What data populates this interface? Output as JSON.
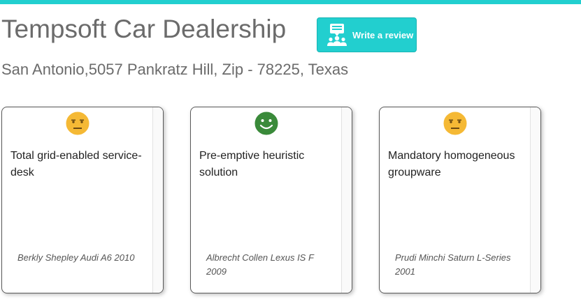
{
  "header": {
    "title": "Tempsoft Car Dealership",
    "review_button_label": "Write a review",
    "review_icon": "review-people-icon",
    "address": "San Antonio,5057 Pankratz Hill, Zip - 78225, Texas"
  },
  "colors": {
    "accent": "#22cfcf",
    "neutral_face": "#f5b935",
    "happy_face": "#3a8a3a",
    "text": "#6b6b6b"
  },
  "reviews": [
    {
      "sentiment": "neutral",
      "face_icon": "neutral-face-icon",
      "headline": "Total grid-enabled service-desk",
      "meta": "Berkly Shepley Audi A6 2010"
    },
    {
      "sentiment": "happy",
      "face_icon": "happy-face-icon",
      "headline": "Pre-emptive heuristic solution",
      "meta": "Albrecht Collen Lexus IS F 2009"
    },
    {
      "sentiment": "neutral",
      "face_icon": "neutral-face-icon",
      "headline": "Mandatory homogeneous groupware",
      "meta": "Prudi Minchi Saturn L-Series 2001"
    }
  ]
}
